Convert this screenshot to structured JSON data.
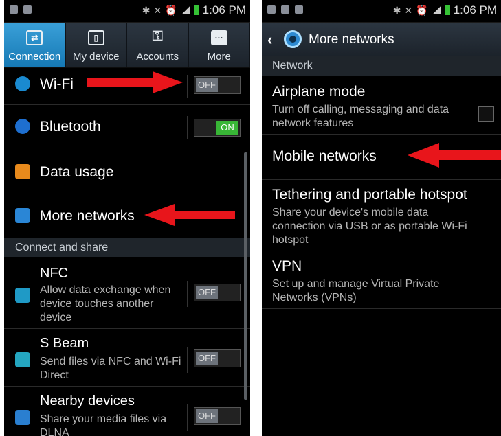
{
  "left": {
    "status_time": "1:06 PM",
    "tabs": [
      {
        "label": "Connection",
        "icon": "connection-icon",
        "active": true
      },
      {
        "label": "My device",
        "icon": "device-icon",
        "active": false
      },
      {
        "label": "Accounts",
        "icon": "key-icon",
        "active": false
      },
      {
        "label": "More",
        "icon": "more-icon",
        "active": false
      }
    ],
    "rows": {
      "wifi": {
        "label": "Wi-Fi",
        "toggle": "OFF"
      },
      "bluetooth": {
        "label": "Bluetooth",
        "toggle": "ON"
      },
      "data_usage": {
        "label": "Data usage"
      },
      "more_networks": {
        "label": "More networks"
      }
    },
    "section_connect": "Connect and share",
    "nfc": {
      "label": "NFC",
      "sub1": "Allow data exchange when",
      "sub2": "device touches another",
      "sub3": "device",
      "toggle": "OFF"
    },
    "sbeam": {
      "label": "S Beam",
      "sub1": "Send files via NFC and Wi-Fi",
      "sub2": "Direct",
      "toggle": "OFF"
    },
    "nearby": {
      "label": "Nearby devices",
      "sub1": "Share your media files via",
      "sub2": "DLNA",
      "toggle": "OFF"
    }
  },
  "right": {
    "status_time": "1:06 PM",
    "title": "More networks",
    "section": "Network",
    "airplane": {
      "label": "Airplane mode",
      "sub1": "Turn off calling, messaging and data",
      "sub2": "network features"
    },
    "mobile": {
      "label": "Mobile networks"
    },
    "tethering": {
      "label": "Tethering and portable hotspot",
      "sub1": "Share your device's mobile data",
      "sub2": "connection via USB or as portable Wi-Fi",
      "sub3": "hotspot"
    },
    "vpn": {
      "label": "VPN",
      "sub1": "Set up and manage Virtual Private",
      "sub2": "Networks (VPNs)"
    }
  },
  "colors": {
    "accent": "#1a8ad0",
    "arrow": "#e8151b",
    "on": "#38b636"
  }
}
